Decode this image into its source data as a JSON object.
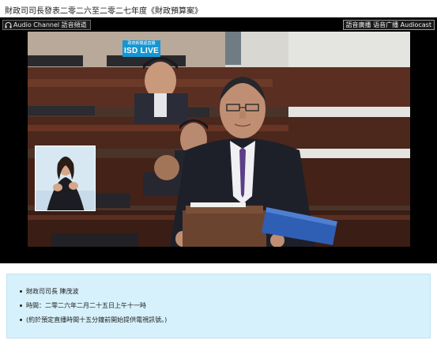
{
  "page": {
    "title": "財政司司長發表二零二六至二零二七年度《財政預算案》"
  },
  "player": {
    "audio_channel_label": "Audio Channel 語音頻道",
    "audiocast_label": "語音廣播 语音广播 Audiocast",
    "live_badge": {
      "top_text": "政府新聞處直播",
      "main_text": "ISD LIVE"
    },
    "icons": {
      "audio_channel": "headphones-icon"
    }
  },
  "info": {
    "items": [
      "財政司司長 陳茂波",
      "時間：二零二六年二月二十五日上午十一時",
      "(約於預定直播時間十五分鐘前開始提供電視訊號。)"
    ]
  },
  "colors": {
    "live_badge": "#1596d4",
    "info_background": "#d6f1fb",
    "player_background": "#000000"
  }
}
